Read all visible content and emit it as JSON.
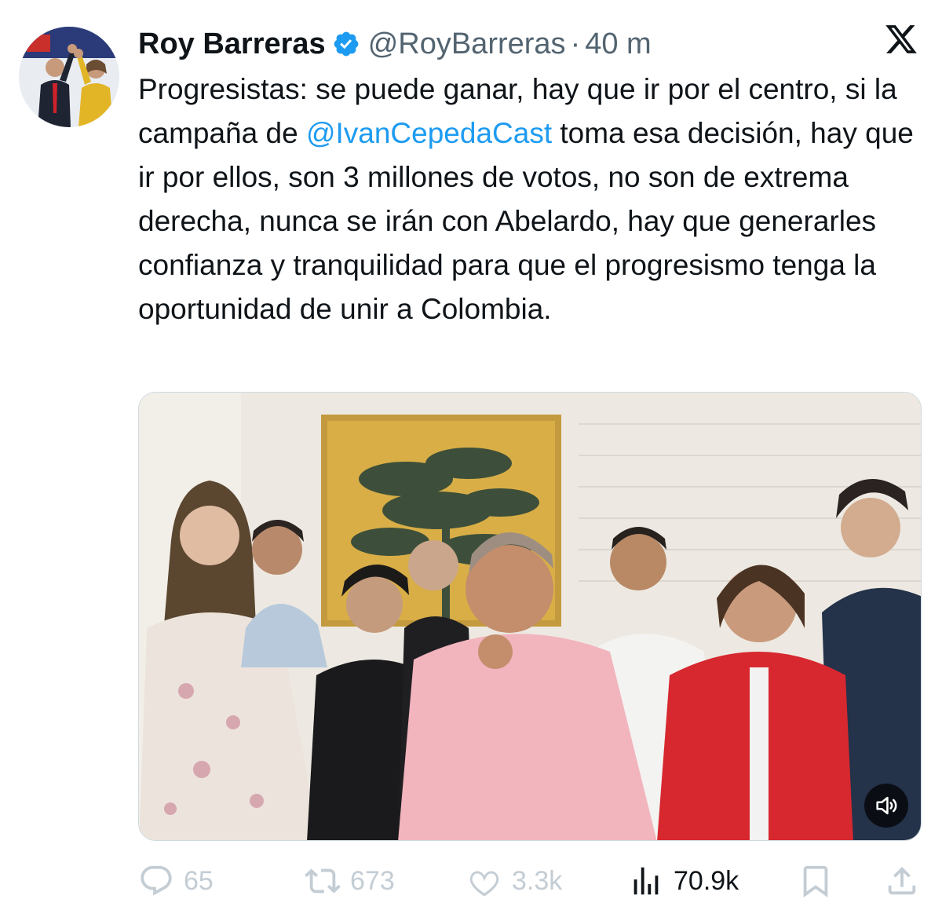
{
  "author": {
    "name": "Roy Barreras",
    "handle": "@RoyBarreras",
    "separator": "·",
    "time": "40 m",
    "verified": true
  },
  "tweet": {
    "text_before_mention": "Progresistas: se puede ganar, hay que ir por el centro, si la campaña de ",
    "mention": "@IvanCepedaCast",
    "text_after_mention": " toma esa decisión, hay que ir por ellos, son 3 millones de votos, no son de extrema derecha, nunca se irán con Abelardo, hay que generarles confianza y tranquilidad para que el progresismo tenga la oportunidad de unir a Colombia."
  },
  "media": {
    "type": "video",
    "mute_icon": "speaker-icon"
  },
  "actions": {
    "replies": "65",
    "reposts": "673",
    "likes": "3.3k",
    "views": "70.9k"
  },
  "colors": {
    "accent": "#1d9bf0",
    "text": "#0f1419",
    "muted": "#536471",
    "faded_actions": "#c4cdd4"
  },
  "icons": [
    "verified-badge-icon",
    "x-logo-icon",
    "reply-icon",
    "repost-icon",
    "like-icon",
    "views-icon",
    "bookmark-icon",
    "share-icon",
    "speaker-icon"
  ]
}
